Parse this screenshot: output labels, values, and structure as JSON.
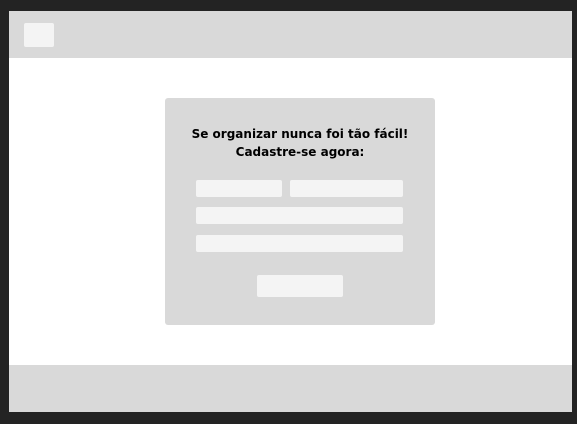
{
  "signup": {
    "title_line1": "Se organizar nunca foi tão fácil!",
    "title_line2": "Cadastre-se agora:",
    "first_name_value": "",
    "last_name_value": "",
    "email_value": "",
    "password_value": "",
    "submit_label": ""
  },
  "colors": {
    "background": "#232323",
    "page": "#ffffff",
    "panel": "#d9d9d9",
    "field": "#f4f4f4",
    "text": "#000000"
  }
}
